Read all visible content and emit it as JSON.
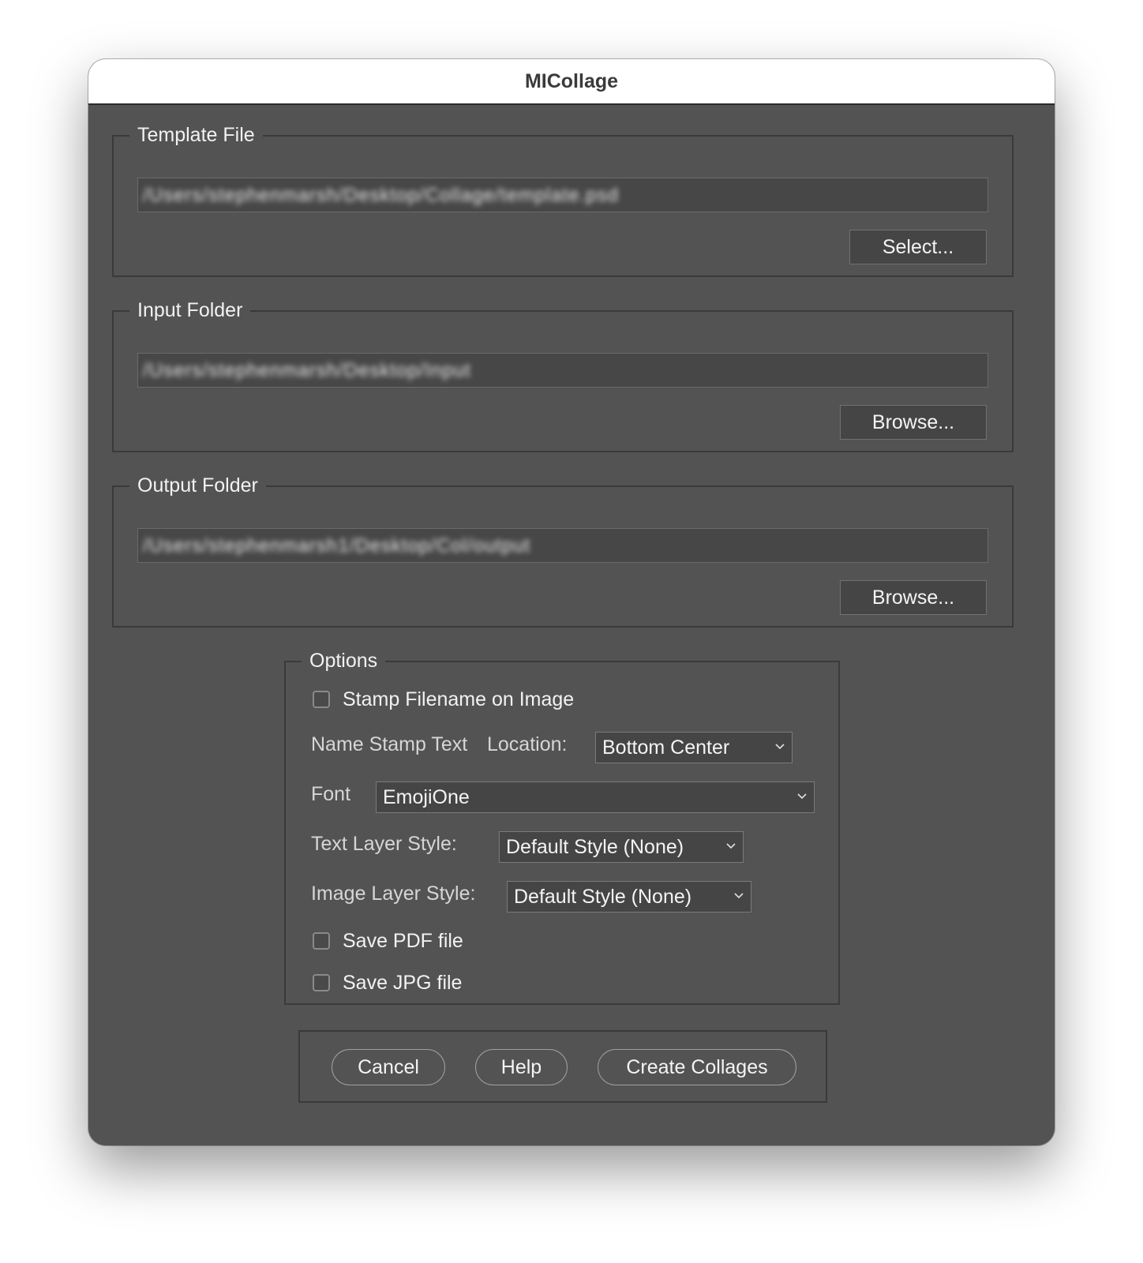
{
  "window": {
    "title": "MICollage"
  },
  "template_file": {
    "legend": "Template File",
    "path": "/Users/stephenmarsh/Desktop/Collage/template.psd",
    "button_label": "Select..."
  },
  "input_folder": {
    "legend": "Input Folder",
    "path": "/Users/stephenmarsh/Desktop/Input",
    "button_label": "Browse..."
  },
  "output_folder": {
    "legend": "Output Folder",
    "path": "/Users/stephenmarsh1/Desktop/Col/output",
    "button_label": "Browse..."
  },
  "options": {
    "legend": "Options",
    "stamp_filename": {
      "label": "Stamp Filename on Image",
      "checked": false
    },
    "name_stamp_label": "Name Stamp Text",
    "location_label": "Location:",
    "location_value": "Bottom Center",
    "font_label": "Font",
    "font_value": "EmojiOne",
    "text_layer_style_label": "Text Layer Style:",
    "text_layer_style_value": "Default Style (None)",
    "image_layer_style_label": "Image Layer Style:",
    "image_layer_style_value": "Default Style (None)",
    "save_pdf": {
      "label": "Save PDF file",
      "checked": false
    },
    "save_jpg": {
      "label": "Save JPG file",
      "checked": false
    }
  },
  "actions": {
    "cancel": "Cancel",
    "help": "Help",
    "create": "Create Collages"
  }
}
